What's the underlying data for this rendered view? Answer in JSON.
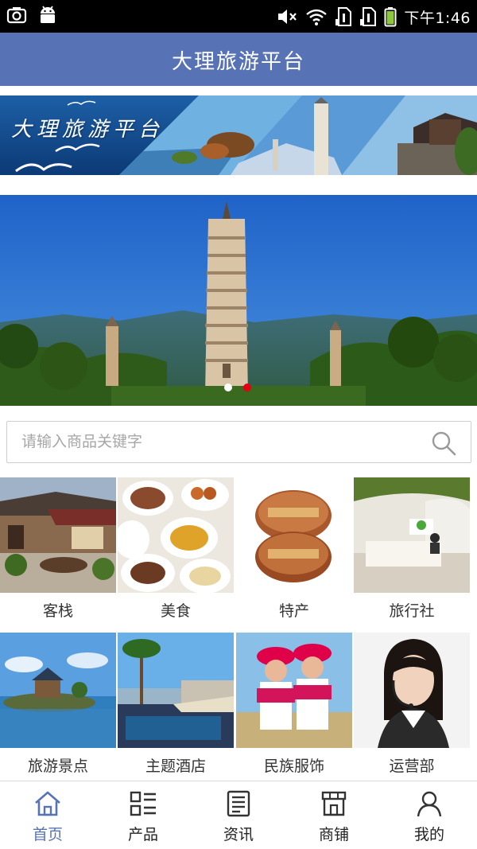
{
  "status_bar": {
    "time": "下午1:46",
    "icons": [
      "screenshot-icon",
      "android-icon",
      "mute-icon",
      "wifi-icon",
      "sim1-icon",
      "sim2-icon",
      "battery-icon"
    ]
  },
  "app": {
    "title": "大理旅游平台",
    "accent": "#5873b5"
  },
  "banner": {
    "text": "大理旅游平台"
  },
  "carousel": {
    "total": 2,
    "active_index": 1,
    "dot_active_color": "#e60012",
    "dot_inactive_color": "#ffffff"
  },
  "search": {
    "placeholder": "请输入商品关键字"
  },
  "categories": [
    {
      "label": "客栈"
    },
    {
      "label": "美食"
    },
    {
      "label": "特产"
    },
    {
      "label": "旅行社"
    },
    {
      "label": "旅游景点"
    },
    {
      "label": "主题酒店"
    },
    {
      "label": "民族服饰"
    },
    {
      "label": "运营部"
    }
  ],
  "bottom_nav": {
    "active": "首页",
    "items": [
      {
        "label": "首页",
        "icon": "home-icon"
      },
      {
        "label": "产品",
        "icon": "product-grid-icon"
      },
      {
        "label": "资讯",
        "icon": "news-icon"
      },
      {
        "label": "商铺",
        "icon": "shop-icon"
      },
      {
        "label": "我的",
        "icon": "user-icon"
      }
    ]
  }
}
